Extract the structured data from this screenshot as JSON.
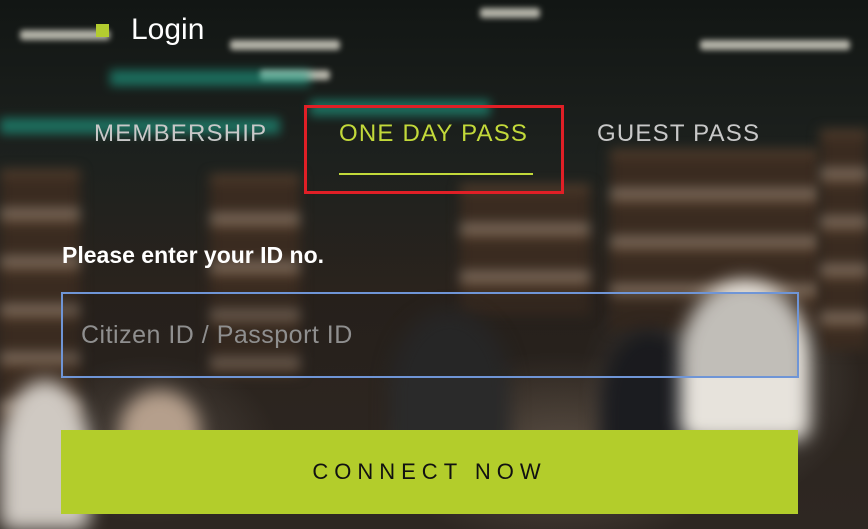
{
  "header": {
    "title": "Login"
  },
  "tabs": [
    {
      "label": "MEMBERSHIP",
      "active": false
    },
    {
      "label": "ONE DAY PASS",
      "active": true
    },
    {
      "label": "GUEST PASS",
      "active": false
    }
  ],
  "form": {
    "id_label": "Please enter your ID no.",
    "id_placeholder": "Citizen ID / Passport ID",
    "id_value": "",
    "submit_label": "CONNECT NOW"
  },
  "colors": {
    "accent": "#b3cd2b",
    "active_tab": "#c2d93a",
    "highlight_box": "#e01f26",
    "input_border": "#6f95d6"
  }
}
